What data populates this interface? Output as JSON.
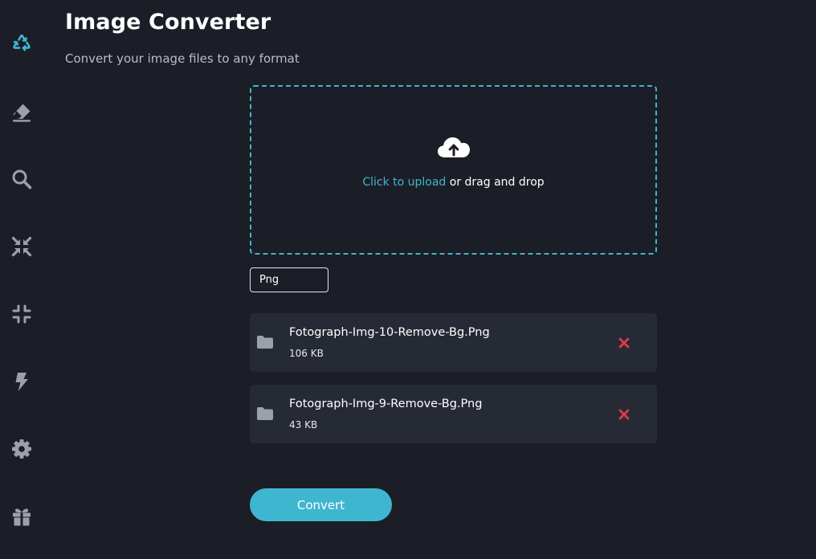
{
  "header": {
    "title": "Image Converter",
    "subtitle": "Convert your image files to any format"
  },
  "sidebar": {
    "items": [
      {
        "icon": "recycle-icon",
        "active": true
      },
      {
        "icon": "eraser-icon"
      },
      {
        "icon": "search-icon"
      },
      {
        "icon": "compress-icon"
      },
      {
        "icon": "shrink-icon"
      },
      {
        "icon": "bolt-icon"
      },
      {
        "icon": "gear-icon"
      },
      {
        "icon": "gift-icon"
      }
    ]
  },
  "upload": {
    "link_text": "Click to upload",
    "rest_text": " or drag and drop",
    "icon": "cloud-upload-icon"
  },
  "format": {
    "selected": "Png"
  },
  "files": [
    {
      "name": "Fotograph-Img-10-Remove-Bg.Png",
      "size": "106 KB"
    },
    {
      "name": "Fotograph-Img-9-Remove-Bg.Png",
      "size": "43 KB"
    }
  ],
  "actions": {
    "convert_label": "Convert"
  },
  "colors": {
    "background": "#1b1e26",
    "accent": "#3fb6cf",
    "card": "#262a34",
    "remove": "#e3384c",
    "icon_muted": "#9ca0a8"
  }
}
